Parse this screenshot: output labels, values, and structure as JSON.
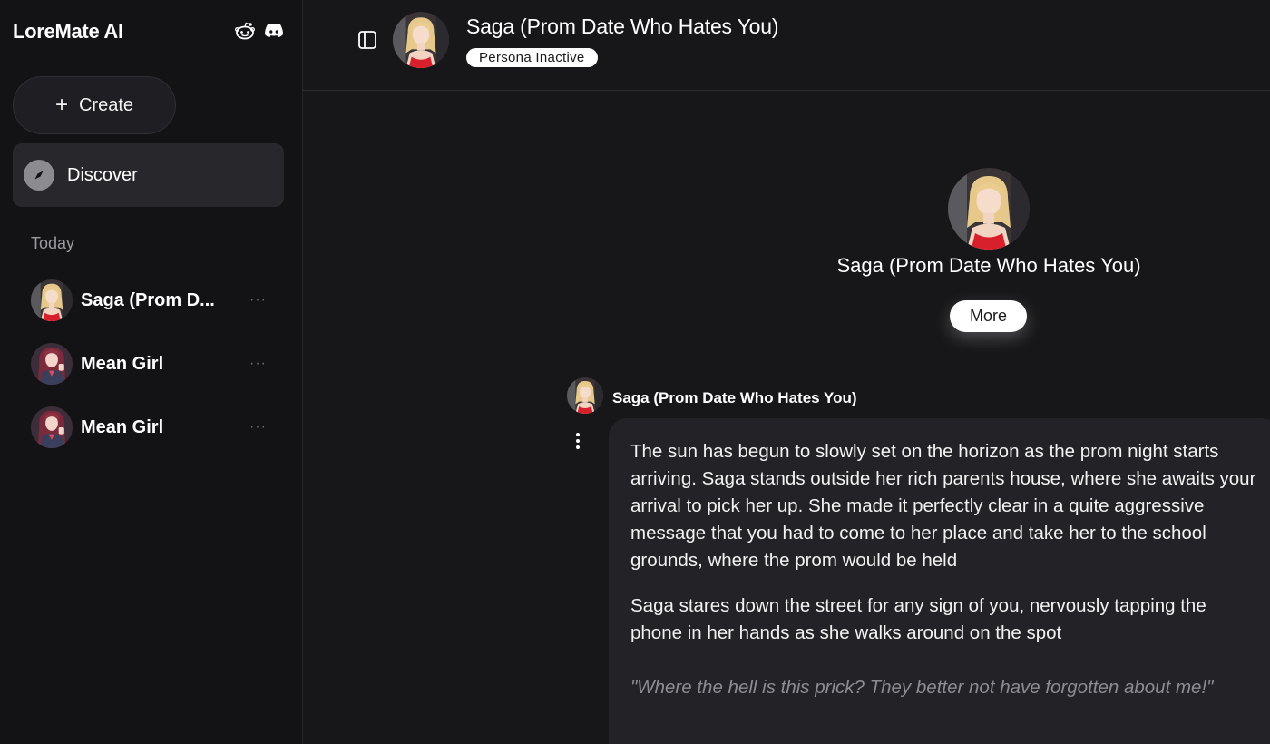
{
  "sidebar": {
    "brand": "LoreMate AI",
    "create_label": "Create",
    "discover_label": "Discover",
    "section_today": "Today",
    "chats": [
      {
        "name": "Saga (Prom D...",
        "avatar": "saga-avatar"
      },
      {
        "name": "Mean Girl",
        "avatar": "mean-girl-avatar"
      },
      {
        "name": "Mean Girl",
        "avatar": "mean-girl-avatar"
      }
    ],
    "more_glyph": "···"
  },
  "header": {
    "title": "Saga (Prom Date Who Hates You)",
    "persona_status": "Persona Inactive"
  },
  "profile": {
    "name": "Saga (Prom Date Who Hates You)",
    "more_label": "More"
  },
  "message": {
    "author": "Saga (Prom Date Who Hates You)",
    "paragraphs": [
      "The sun has begun to slowly set on the horizon as the prom night starts arriving. Saga stands outside her rich parents house, where she awaits your arrival to pick her up. She made it perfectly clear in a quite aggressive message that you had to come to her place and take her to the school grounds, where the prom would be held",
      "Saga stares down the street for any sign of you, nervously tapping the phone in her hands as she walks around on the spot"
    ],
    "quote": "\"Where the hell is this prick? They better not have forgotten about me!\""
  },
  "colors": {
    "background": "#17171a",
    "sidebar": "#131316",
    "bubble": "#222227",
    "badge": "#ffffff"
  }
}
